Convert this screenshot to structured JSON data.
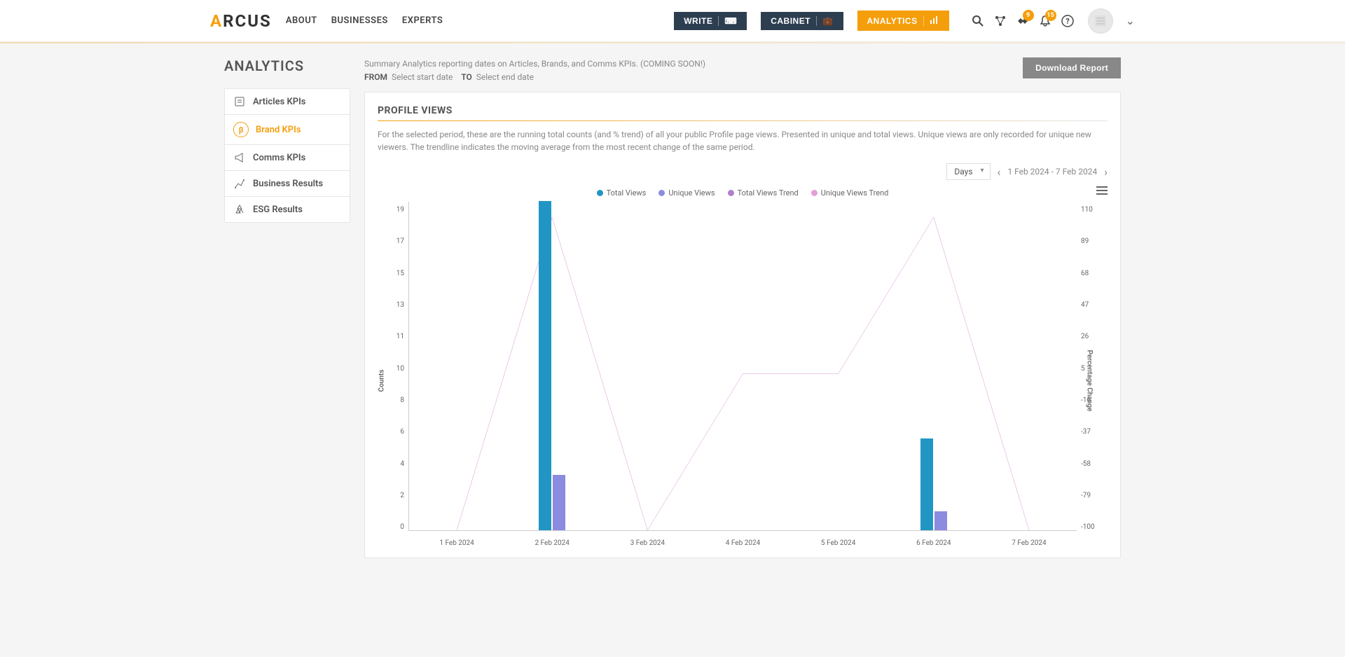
{
  "brand": "ARCUS",
  "nav": {
    "about": "ABOUT",
    "businesses": "BUSINESSES",
    "experts": "EXPERTS"
  },
  "actions": {
    "write": "WRITE",
    "cabinet": "CABINET",
    "analytics": "ANALYTICS"
  },
  "badges": {
    "handshake": "9",
    "bell": "15"
  },
  "sidebar": {
    "title": "ANALYTICS",
    "items": [
      {
        "label": "Articles KPIs"
      },
      {
        "label": "Brand KPIs"
      },
      {
        "label": "Comms KPIs"
      },
      {
        "label": "Business Results"
      },
      {
        "label": "ESG Results"
      }
    ]
  },
  "header": {
    "summary": "Summary Analytics reporting dates on Articles, Brands, and Comms KPIs. (COMING SOON!)",
    "from_label": "FROM",
    "from_value": "Select start date",
    "to_label": "TO",
    "to_value": "Select end date",
    "download": "Download Report"
  },
  "card": {
    "title": "PROFILE VIEWS",
    "desc": "For the selected period, these are the running total counts (and % trend) of all your public Profile page views. Presented in unique and total views. Unique views are only recorded for unique new viewers. The trendline indicates the moving average from the most recent change of the same period.",
    "period_select": "Days",
    "date_range": "1 Feb 2024 - 7 Feb 2024"
  },
  "legend": {
    "total": "Total Views",
    "unique": "Unique Views",
    "total_trend": "Total Views Trend",
    "unique_trend": "Unique Views Trend"
  },
  "chart_data": {
    "type": "bar",
    "categories": [
      "1 Feb 2024",
      "2 Feb 2024",
      "3 Feb 2024",
      "4 Feb 2024",
      "5 Feb 2024",
      "6 Feb 2024",
      "7 Feb 2024"
    ],
    "series": [
      {
        "name": "Total Views",
        "values": [
          0,
          19,
          0,
          0,
          0,
          5.3,
          0
        ],
        "color": "#2196c4"
      },
      {
        "name": "Unique Views",
        "values": [
          0,
          3.2,
          0,
          0,
          0,
          1.1,
          0
        ],
        "color": "#8b8be0"
      },
      {
        "name": "Total Views Trend",
        "values": [
          -100,
          100,
          -100,
          0,
          0,
          100,
          -100
        ],
        "color": "#b07fc9"
      },
      {
        "name": "Unique Views Trend",
        "values": [
          -100,
          100,
          -100,
          0,
          0,
          100,
          -100
        ],
        "color": "#e69ed6"
      }
    ],
    "y_left": {
      "label": "Counts",
      "ticks": [
        19,
        17,
        15,
        13,
        11,
        10,
        8,
        6,
        4,
        2,
        0
      ],
      "min": 0,
      "max": 19
    },
    "y_right": {
      "label": "Percentage Change",
      "ticks": [
        110,
        89,
        68,
        47,
        26,
        5,
        -16,
        -37,
        -58,
        -79,
        -100
      ],
      "min": -100,
      "max": 110
    }
  }
}
